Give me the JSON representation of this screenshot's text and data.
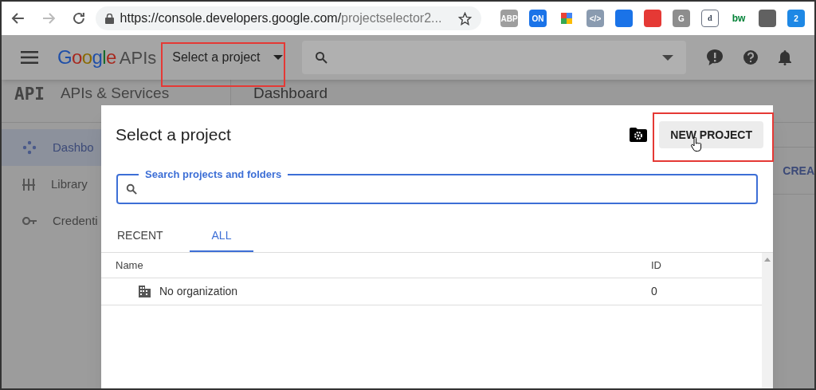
{
  "browser": {
    "url_host": "https://console.developers.google.com/",
    "url_path": "projectselector2...",
    "extensions": [
      {
        "kind": "abp",
        "label": "ABP",
        "color": "#9e9e9e"
      },
      {
        "kind": "on",
        "label": "ON",
        "color": "#1a73e8"
      },
      {
        "kind": "google",
        "color": "#ffffff"
      },
      {
        "kind": "code",
        "label": "</>",
        "color": "#8a9bb0"
      },
      {
        "kind": "blue",
        "color": "#1a73e8"
      },
      {
        "kind": "red",
        "color": "#e53935"
      },
      {
        "kind": "g",
        "label": "G",
        "color": "#8d8d8d"
      },
      {
        "kind": "d",
        "label": "d",
        "color": "#ffffff"
      },
      {
        "kind": "bw",
        "label": "bw",
        "color": "#ffffff"
      },
      {
        "kind": "q",
        "color": "#616161"
      },
      {
        "kind": "ghost",
        "label": "2",
        "color": "#1e88e5"
      }
    ]
  },
  "header": {
    "logo": "Google",
    "product": "APIs",
    "project_selector": {
      "label": "Select a project",
      "highlighted": true
    }
  },
  "sidebar": {
    "logo": "API",
    "title": "APIs & Services",
    "items": [
      {
        "label": "Dashbo",
        "kind": "dashboard",
        "selected": true
      },
      {
        "label": "Library",
        "kind": "library",
        "selected": false
      },
      {
        "label": "Credenti",
        "kind": "key",
        "selected": false
      }
    ]
  },
  "main": {
    "title": "Dashboard",
    "action": "CREA"
  },
  "dialog": {
    "title": "Select a project",
    "new_project": {
      "label": "NEW PROJECT",
      "highlighted": true
    },
    "search": {
      "label": "Search projects and folders"
    },
    "tabs": [
      {
        "label": "RECENT",
        "selected": false
      },
      {
        "label": "ALL",
        "selected": true
      }
    ],
    "columns": [
      "Name",
      "ID"
    ],
    "rows": [
      {
        "name": "No organization",
        "id": "0"
      }
    ]
  }
}
